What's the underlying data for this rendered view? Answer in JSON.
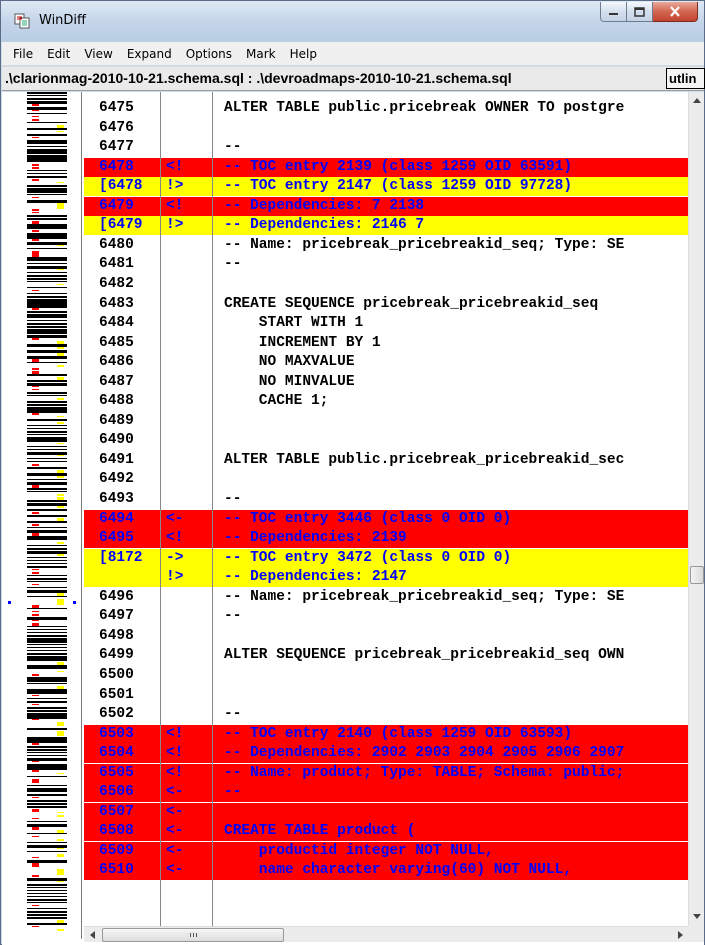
{
  "window": {
    "title": "WinDiff",
    "app_icon": "windiff-icon",
    "caption_buttons": [
      "minimize-icon",
      "maximize-icon",
      "close-icon"
    ]
  },
  "menu": [
    "File",
    "Edit",
    "View",
    "Expand",
    "Options",
    "Mark",
    "Help"
  ],
  "pathbar": {
    "path": ".\\clarionmag-2010-10-21.schema.sql : .\\devroadmaps-2010-10-21.schema.sql",
    "outline_button": "utlin"
  },
  "colors": {
    "left_only_bg": "#ff0000",
    "right_only_bg": "#ffff00",
    "diff_text": "#0000ff",
    "normal_text": "#000000"
  },
  "lines": [
    {
      "num": "6475",
      "mark": "",
      "text": "ALTER TABLE public.pricebreak OWNER TO postgre",
      "type": "normal"
    },
    {
      "num": "6476",
      "mark": "",
      "text": "",
      "type": "normal"
    },
    {
      "num": "6477",
      "mark": "",
      "text": "--",
      "type": "normal"
    },
    {
      "num": "6478",
      "mark": "<!",
      "text": "-- TOC entry 2139 (class 1259 OID 63591)",
      "type": "red"
    },
    {
      "num": "[6478",
      "mark": "!>",
      "text": "-- TOC entry 2147 (class 1259 OID 97728)",
      "type": "yellow"
    },
    {
      "num": "6479",
      "mark": "<!",
      "text": "-- Dependencies: 7 2138",
      "type": "red"
    },
    {
      "num": "[6479",
      "mark": "!>",
      "text": "-- Dependencies: 2146 7",
      "type": "yellow"
    },
    {
      "num": "6480",
      "mark": "",
      "text": "-- Name: pricebreak_pricebreakid_seq; Type: SE",
      "type": "normal"
    },
    {
      "num": "6481",
      "mark": "",
      "text": "--",
      "type": "normal"
    },
    {
      "num": "6482",
      "mark": "",
      "text": "",
      "type": "normal"
    },
    {
      "num": "6483",
      "mark": "",
      "text": "CREATE SEQUENCE pricebreak_pricebreakid_seq",
      "type": "normal"
    },
    {
      "num": "6484",
      "mark": "",
      "text": "    START WITH 1",
      "type": "normal"
    },
    {
      "num": "6485",
      "mark": "",
      "text": "    INCREMENT BY 1",
      "type": "normal"
    },
    {
      "num": "6486",
      "mark": "",
      "text": "    NO MAXVALUE",
      "type": "normal"
    },
    {
      "num": "6487",
      "mark": "",
      "text": "    NO MINVALUE",
      "type": "normal"
    },
    {
      "num": "6488",
      "mark": "",
      "text": "    CACHE 1;",
      "type": "normal"
    },
    {
      "num": "6489",
      "mark": "",
      "text": "",
      "type": "normal"
    },
    {
      "num": "6490",
      "mark": "",
      "text": "",
      "type": "normal"
    },
    {
      "num": "6491",
      "mark": "",
      "text": "ALTER TABLE public.pricebreak_pricebreakid_sec",
      "type": "normal"
    },
    {
      "num": "6492",
      "mark": "",
      "text": "",
      "type": "normal"
    },
    {
      "num": "6493",
      "mark": "",
      "text": "--",
      "type": "normal"
    },
    {
      "num": "6494",
      "mark": "<-",
      "text": "-- TOC entry 3446 (class 0 OID 0)",
      "type": "red"
    },
    {
      "num": "6495",
      "mark": "<!",
      "text": "-- Dependencies: 2139",
      "type": "red"
    },
    {
      "num": "[8172",
      "mark": "->",
      "text": "-- TOC entry 3472 (class 0 OID 0)",
      "type": "yellow"
    },
    {
      "num": "",
      "mark": "!>",
      "text": "-- Dependencies: 2147",
      "type": "yellow"
    },
    {
      "num": "6496",
      "mark": "",
      "text": "-- Name: pricebreak_pricebreakid_seq; Type: SE",
      "type": "normal"
    },
    {
      "num": "6497",
      "mark": "",
      "text": "--",
      "type": "normal"
    },
    {
      "num": "6498",
      "mark": "",
      "text": "",
      "type": "normal"
    },
    {
      "num": "6499",
      "mark": "",
      "text": "ALTER SEQUENCE pricebreak_pricebreakid_seq OWN",
      "type": "normal"
    },
    {
      "num": "6500",
      "mark": "",
      "text": "",
      "type": "normal"
    },
    {
      "num": "6501",
      "mark": "",
      "text": "",
      "type": "normal"
    },
    {
      "num": "6502",
      "mark": "",
      "text": "--",
      "type": "normal"
    },
    {
      "num": "6503",
      "mark": "<!",
      "text": "-- TOC entry 2140 (class 1259 OID 63593)",
      "type": "red"
    },
    {
      "num": "6504",
      "mark": "<!",
      "text": "-- Dependencies: 2902 2903 2904 2905 2906 2907",
      "type": "red"
    },
    {
      "num": "6505",
      "mark": "<!",
      "text": "-- Name: product; Type: TABLE; Schema: public;",
      "type": "red"
    },
    {
      "num": "6506",
      "mark": "<-",
      "text": "--",
      "type": "red"
    },
    {
      "num": "6507",
      "mark": "<-",
      "text": "",
      "type": "red"
    },
    {
      "num": "6508",
      "mark": "<-",
      "text": "CREATE TABLE product (",
      "type": "red"
    },
    {
      "num": "6509",
      "mark": "<-",
      "text": "    productid integer NOT NULL,",
      "type": "red"
    },
    {
      "num": "6510",
      "mark": "<-",
      "text": "    name character varying(60) NOT NULL,",
      "type": "red"
    }
  ]
}
